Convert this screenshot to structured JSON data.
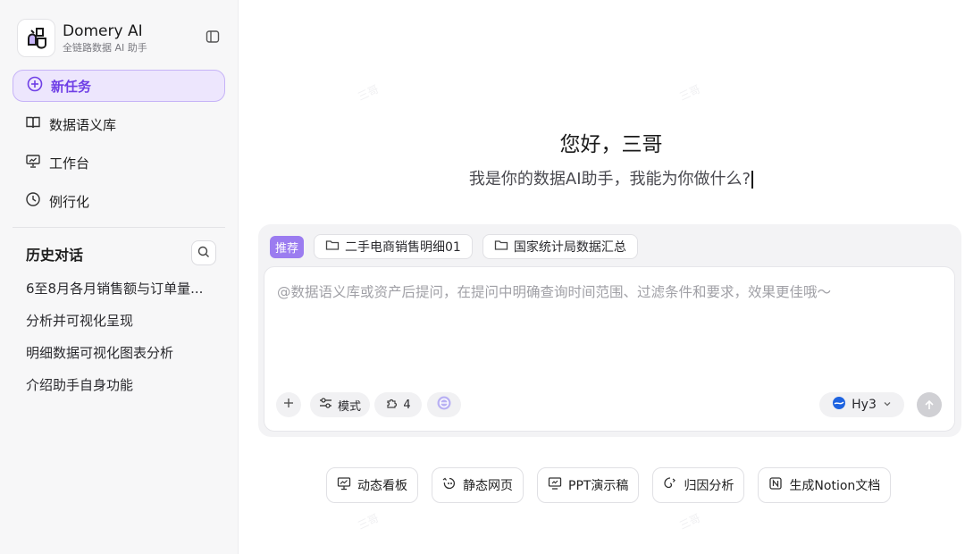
{
  "brand": {
    "name": "Domery AI",
    "subtitle": "全链路数据 AI 助手"
  },
  "sidebar": {
    "new_task": "新任务",
    "nav": [
      {
        "label": "数据语义库",
        "icon": "book-icon"
      },
      {
        "label": "工作台",
        "icon": "presentation-board-icon"
      },
      {
        "label": "例行化",
        "icon": "clock-icon"
      }
    ],
    "history_title": "历史对话",
    "history": [
      "6至8月各月销售额与订单量...",
      "分析并可视化呈现",
      "明细数据可视化图表分析",
      "介绍助手自身功能"
    ]
  },
  "main": {
    "greeting": "您好，三哥",
    "subgreeting": "我是你的数据AI助手，我能为你做什么?",
    "recommend_label": "推荐",
    "recommend_chips": [
      "二手电商销售明细01",
      "国家统计局数据汇总"
    ],
    "input_placeholder": "@数据语义库或资产后提问，在提问中明确查询时间范围、过滤条件和要求，效果更佳哦～",
    "tools": {
      "mode_label": "模式",
      "skills_count": "4",
      "model": "Hy3"
    },
    "quick_actions": [
      "动态看板",
      "静态网页",
      "PPT演示稿",
      "归因分析",
      "生成Notion文档"
    ],
    "watermark": "三哥"
  },
  "colors": {
    "accent": "#6f3fe6",
    "accent_bg": "#ede6fd",
    "recommend_badge": "#9b7cf0"
  }
}
